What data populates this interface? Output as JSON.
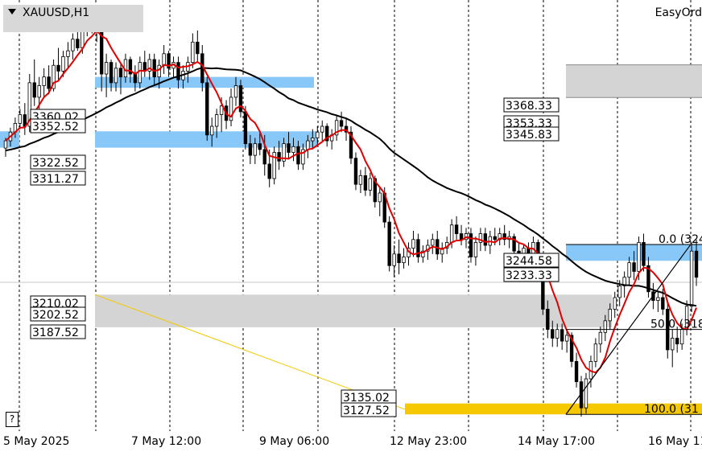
{
  "header": {
    "symbol": "XAUUSD,H1",
    "ea_label": "EasyOrd"
  },
  "help_button": "?",
  "chart_data": {
    "type": "candlestick",
    "title": "XAUUSD,H1",
    "ylim": [
      3116,
      3413
    ],
    "grid": "vertical-dotted",
    "x_ticks": [
      "5 May 2025",
      "7 May 12:00",
      "9 May 06:00",
      "12 May 23:00",
      "14 May 17:00",
      "16 May 11"
    ],
    "candles": [
      [
        3311,
        3318,
        3305,
        3316
      ],
      [
        3316,
        3325,
        3312,
        3322
      ],
      [
        3322,
        3332,
        3318,
        3328
      ],
      [
        3328,
        3338,
        3324,
        3334
      ],
      [
        3334,
        3342,
        3320,
        3326
      ],
      [
        3326,
        3362,
        3322,
        3356
      ],
      [
        3356,
        3372,
        3340,
        3346
      ],
      [
        3346,
        3360,
        3338,
        3354
      ],
      [
        3354,
        3366,
        3346,
        3360
      ],
      [
        3360,
        3368,
        3348,
        3352
      ],
      [
        3352,
        3372,
        3350,
        3368
      ],
      [
        3368,
        3380,
        3358,
        3364
      ],
      [
        3364,
        3378,
        3360,
        3374
      ],
      [
        3374,
        3384,
        3366,
        3378
      ],
      [
        3378,
        3390,
        3372,
        3386
      ],
      [
        3386,
        3395,
        3378,
        3380
      ],
      [
        3380,
        3398,
        3376,
        3394
      ],
      [
        3394,
        3404,
        3388,
        3398
      ],
      [
        3398,
        3406,
        3390,
        3392
      ],
      [
        3392,
        3408,
        3384,
        3402
      ],
      [
        3402,
        3398,
        3350,
        3362
      ],
      [
        3362,
        3376,
        3346,
        3370
      ],
      [
        3370,
        3372,
        3350,
        3356
      ],
      [
        3356,
        3370,
        3350,
        3366
      ],
      [
        3366,
        3370,
        3348,
        3360
      ],
      [
        3360,
        3376,
        3356,
        3372
      ],
      [
        3372,
        3374,
        3356,
        3362
      ],
      [
        3362,
        3368,
        3350,
        3356
      ],
      [
        3356,
        3374,
        3352,
        3370
      ],
      [
        3370,
        3378,
        3360,
        3364
      ],
      [
        3364,
        3376,
        3358,
        3372
      ],
      [
        3372,
        3376,
        3354,
        3360
      ],
      [
        3360,
        3372,
        3352,
        3368
      ],
      [
        3368,
        3382,
        3362,
        3376
      ],
      [
        3376,
        3378,
        3360,
        3366
      ],
      [
        3366,
        3374,
        3360,
        3370
      ],
      [
        3370,
        3374,
        3352,
        3358
      ],
      [
        3358,
        3368,
        3352,
        3364
      ],
      [
        3364,
        3374,
        3356,
        3370
      ],
      [
        3370,
        3390,
        3366,
        3384
      ],
      [
        3384,
        3392,
        3370,
        3376
      ],
      [
        3376,
        3382,
        3350,
        3356
      ],
      [
        3356,
        3360,
        3316,
        3320
      ],
      [
        3320,
        3332,
        3312,
        3326
      ],
      [
        3326,
        3338,
        3318,
        3334
      ],
      [
        3334,
        3346,
        3322,
        3340
      ],
      [
        3340,
        3344,
        3324,
        3330
      ],
      [
        3330,
        3352,
        3326,
        3346
      ],
      [
        3346,
        3360,
        3340,
        3354
      ],
      [
        3354,
        3358,
        3332,
        3336
      ],
      [
        3336,
        3340,
        3310,
        3314
      ],
      [
        3314,
        3320,
        3300,
        3306
      ],
      [
        3306,
        3318,
        3300,
        3314
      ],
      [
        3314,
        3322,
        3306,
        3310
      ],
      [
        3310,
        3320,
        3292,
        3300
      ],
      [
        3300,
        3310,
        3284,
        3290
      ],
      [
        3290,
        3312,
        3286,
        3308
      ],
      [
        3308,
        3316,
        3296,
        3302
      ],
      [
        3302,
        3318,
        3298,
        3314
      ],
      [
        3314,
        3322,
        3304,
        3308
      ],
      [
        3308,
        3318,
        3302,
        3312
      ],
      [
        3312,
        3316,
        3296,
        3300
      ],
      [
        3300,
        3314,
        3296,
        3310
      ],
      [
        3310,
        3320,
        3304,
        3316
      ],
      [
        3316,
        3324,
        3310,
        3318
      ],
      [
        3318,
        3326,
        3312,
        3322
      ],
      [
        3322,
        3330,
        3316,
        3326
      ],
      [
        3326,
        3328,
        3312,
        3316
      ],
      [
        3316,
        3324,
        3310,
        3320
      ],
      [
        3320,
        3334,
        3316,
        3330
      ],
      [
        3330,
        3336,
        3322,
        3326
      ],
      [
        3326,
        3332,
        3316,
        3322
      ],
      [
        3322,
        3326,
        3300,
        3304
      ],
      [
        3304,
        3308,
        3282,
        3286
      ],
      [
        3286,
        3296,
        3280,
        3292
      ],
      [
        3292,
        3298,
        3278,
        3282
      ],
      [
        3282,
        3294,
        3278,
        3290
      ],
      [
        3290,
        3292,
        3270,
        3274
      ],
      [
        3274,
        3284,
        3264,
        3280
      ],
      [
        3280,
        3284,
        3256,
        3260
      ],
      [
        3260,
        3264,
        3226,
        3230
      ],
      [
        3230,
        3244,
        3222,
        3238
      ],
      [
        3238,
        3248,
        3224,
        3232
      ],
      [
        3232,
        3242,
        3228,
        3236
      ],
      [
        3236,
        3246,
        3230,
        3242
      ],
      [
        3242,
        3254,
        3236,
        3248
      ],
      [
        3248,
        3252,
        3232,
        3236
      ],
      [
        3236,
        3244,
        3232,
        3240
      ],
      [
        3240,
        3248,
        3234,
        3244
      ],
      [
        3244,
        3252,
        3238,
        3248
      ],
      [
        3248,
        3254,
        3234,
        3238
      ],
      [
        3238,
        3246,
        3232,
        3242
      ],
      [
        3242,
        3250,
        3238,
        3246
      ],
      [
        3246,
        3262,
        3242,
        3258
      ],
      [
        3258,
        3264,
        3248,
        3252
      ],
      [
        3252,
        3258,
        3244,
        3248
      ],
      [
        3248,
        3256,
        3242,
        3252
      ],
      [
        3252,
        3256,
        3232,
        3236
      ],
      [
        3236,
        3250,
        3230,
        3246
      ],
      [
        3246,
        3256,
        3240,
        3252
      ],
      [
        3252,
        3256,
        3240,
        3244
      ],
      [
        3244,
        3254,
        3238,
        3250
      ],
      [
        3250,
        3256,
        3244,
        3248
      ],
      [
        3248,
        3256,
        3244,
        3252
      ],
      [
        3252,
        3258,
        3244,
        3248
      ],
      [
        3248,
        3254,
        3242,
        3250
      ],
      [
        3250,
        3252,
        3236,
        3240
      ],
      [
        3240,
        3246,
        3232,
        3236
      ],
      [
        3236,
        3244,
        3230,
        3242
      ],
      [
        3242,
        3246,
        3232,
        3236
      ],
      [
        3236,
        3250,
        3232,
        3246
      ],
      [
        3246,
        3248,
        3226,
        3230
      ],
      [
        3230,
        3234,
        3196,
        3200
      ],
      [
        3200,
        3206,
        3180,
        3186
      ],
      [
        3186,
        3192,
        3174,
        3180
      ],
      [
        3180,
        3190,
        3174,
        3186
      ],
      [
        3186,
        3190,
        3172,
        3178
      ],
      [
        3178,
        3186,
        3170,
        3182
      ],
      [
        3182,
        3184,
        3160,
        3164
      ],
      [
        3164,
        3170,
        3146,
        3150
      ],
      [
        3150,
        3154,
        3126,
        3132
      ],
      [
        3132,
        3156,
        3128,
        3152
      ],
      [
        3152,
        3168,
        3146,
        3164
      ],
      [
        3164,
        3180,
        3160,
        3176
      ],
      [
        3176,
        3188,
        3170,
        3184
      ],
      [
        3184,
        3196,
        3178,
        3192
      ],
      [
        3192,
        3204,
        3186,
        3200
      ],
      [
        3200,
        3212,
        3194,
        3208
      ],
      [
        3208,
        3220,
        3202,
        3216
      ],
      [
        3216,
        3226,
        3208,
        3222
      ],
      [
        3222,
        3236,
        3216,
        3232
      ],
      [
        3232,
        3240,
        3220,
        3226
      ],
      [
        3226,
        3250,
        3220,
        3246
      ],
      [
        3246,
        3252,
        3226,
        3230
      ],
      [
        3230,
        3236,
        3208,
        3212
      ],
      [
        3212,
        3218,
        3200,
        3206
      ],
      [
        3206,
        3212,
        3198,
        3208
      ],
      [
        3208,
        3214,
        3196,
        3200
      ],
      [
        3200,
        3206,
        3166,
        3172
      ],
      [
        3172,
        3186,
        3160,
        3180
      ],
      [
        3180,
        3188,
        3170,
        3176
      ],
      [
        3176,
        3190,
        3172,
        3186
      ],
      [
        3186,
        3206,
        3182,
        3202
      ],
      [
        3202,
        3246,
        3198,
        3240
      ],
      [
        3240,
        3248,
        3216,
        3222
      ]
    ],
    "overlays": {
      "sma_fast": {
        "color": "#e00000"
      },
      "sma_slow": {
        "color": "#000000"
      }
    },
    "zones": [
      {
        "label": "zone-blue-upper",
        "low": 3352.52,
        "high": 3360.02,
        "color": "#88c8f8"
      },
      {
        "label": "zone-blue-lower",
        "low": 3311.27,
        "high": 3322.52,
        "color": "#88c8f8"
      },
      {
        "label": "zone-grey-upper",
        "low": 3345.83,
        "high": 3368.33,
        "color": "#d4d4d4"
      },
      {
        "label": "zone-blue-mid",
        "low": 3233.33,
        "high": 3244.58,
        "color": "#88c8f8"
      },
      {
        "label": "zone-grey-lower",
        "low": 3187.52,
        "high": 3210.02,
        "color": "#d4d4d4"
      },
      {
        "label": "zone-gold",
        "low": 3127.52,
        "high": 3135.02,
        "color": "#f6c800"
      }
    ],
    "price_labels": [
      "3360.02",
      "3352.52",
      "3322.52",
      "3311.27",
      "3368.33",
      "3353.33",
      "3345.83",
      "3244.58",
      "3233.33",
      "3210.02",
      "3202.52",
      "3187.52",
      "3135.02",
      "3127.52"
    ],
    "fib_labels": [
      "0.0 (324",
      "50.0 (318",
      "100.0 (31"
    ]
  }
}
